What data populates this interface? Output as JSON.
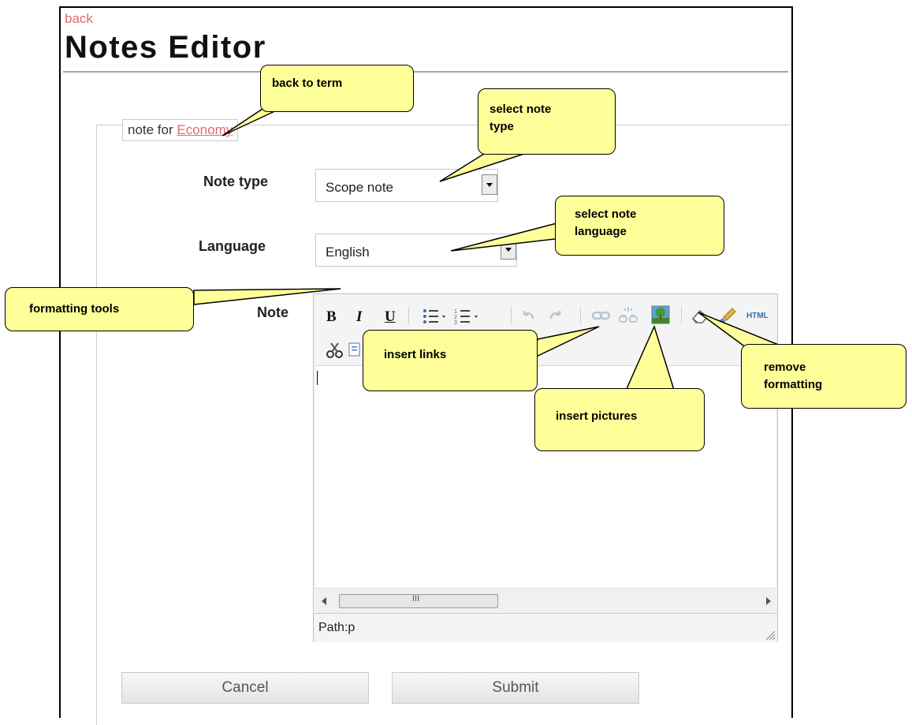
{
  "header": {
    "back_label": "back",
    "title": "Notes Editor"
  },
  "fieldset": {
    "legend_prefix": "note for ",
    "legend_link": "Economy"
  },
  "form": {
    "note_type": {
      "label": "Note type",
      "value": "Scope note"
    },
    "language": {
      "label": "Language",
      "value": "English"
    },
    "note": {
      "label": "Note"
    }
  },
  "editor": {
    "toolbar": {
      "bold": "B",
      "italic": "I",
      "underline": "U",
      "html": "HTML",
      "icons": [
        "bold-icon",
        "italic-icon",
        "underline-icon",
        "bullet-list-icon",
        "numbered-list-icon",
        "undo-icon",
        "redo-icon",
        "link-icon",
        "unlink-icon",
        "image-icon",
        "eraser-icon",
        "paint-brush-icon",
        "html-icon",
        "cut-icon",
        "copy-icon"
      ]
    },
    "scroll_marker": "III",
    "status_path": "Path:p"
  },
  "buttons": {
    "cancel": "Cancel",
    "submit": "Submit"
  },
  "callouts": {
    "back_to_term": "back to term",
    "select_note_type": "select note type",
    "select_note_language": "select note language",
    "formatting_tools": "formatting tools",
    "insert_links": "insert links",
    "insert_pictures": "insert pictures",
    "remove_formatting": "remove formatting"
  },
  "colors": {
    "link": "#e26a6a",
    "callout_fill": "#ffff99",
    "toolbar_bg": "#f4f4f4"
  }
}
